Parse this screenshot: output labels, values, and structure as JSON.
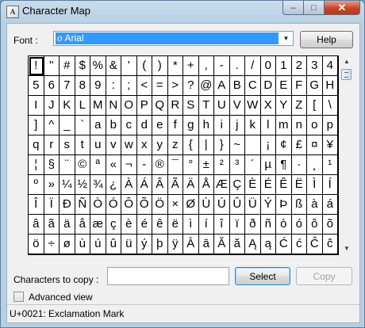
{
  "window": {
    "title": "Character Map",
    "icon_glyph": "A",
    "minimize_glyph": "–",
    "maximize_glyph": "□",
    "close_glyph": "✕"
  },
  "font": {
    "label": "Font :",
    "selected": "Arial",
    "icon": "O",
    "dropdown_glyph": "▼"
  },
  "help_label": "Help",
  "characters": [
    "!",
    "\"",
    "#",
    "$",
    "%",
    "&",
    "'",
    "(",
    ")",
    "*",
    "+",
    ",",
    "-",
    ".",
    "/",
    "0",
    "1",
    "2",
    "3",
    "4",
    "5",
    "6",
    "7",
    "8",
    "9",
    ":",
    ";",
    "<",
    "=",
    ">",
    "?",
    "@",
    "A",
    "B",
    "C",
    "D",
    "E",
    "F",
    "G",
    "H",
    "I",
    "J",
    "K",
    "L",
    "M",
    "N",
    "O",
    "P",
    "Q",
    "R",
    "S",
    "T",
    "U",
    "V",
    "W",
    "X",
    "Y",
    "Z",
    "[",
    "\\",
    "]",
    "^",
    "_",
    "`",
    "a",
    "b",
    "c",
    "d",
    "e",
    "f",
    "g",
    "h",
    "i",
    "j",
    "k",
    "l",
    "m",
    "n",
    "o",
    "p",
    "q",
    "r",
    "s",
    "t",
    "u",
    "v",
    "w",
    "x",
    "y",
    "z",
    "{",
    "|",
    "}",
    "~",
    " ",
    "¡",
    "¢",
    "£",
    "¤",
    "¥",
    "¦",
    "§",
    "¨",
    "©",
    "ª",
    "«",
    "¬",
    "-",
    "®",
    "¯",
    "°",
    "±",
    "²",
    "³",
    "´",
    "µ",
    "¶",
    "·",
    "¸",
    "¹",
    "º",
    "»",
    "¼",
    "½",
    "¾",
    "¿",
    "À",
    "Á",
    "Â",
    "Ã",
    "Ä",
    "Å",
    "Æ",
    "Ç",
    "È",
    "É",
    "Ê",
    "Ë",
    "Ì",
    "Í",
    "Î",
    "Ï",
    "Ð",
    "Ñ",
    "Ò",
    "Ó",
    "Ô",
    "Õ",
    "Ö",
    "×",
    "Ø",
    "Ù",
    "Ú",
    "Û",
    "Ü",
    "Ý",
    "Þ",
    "ß",
    "à",
    "á",
    "â",
    "ã",
    "ä",
    "å",
    "æ",
    "ç",
    "è",
    "é",
    "ê",
    "ë",
    "ì",
    "í",
    "î",
    "ï",
    "ð",
    "ñ",
    "ò",
    "ó",
    "ô",
    "õ",
    "ö",
    "÷",
    "ø",
    "ù",
    "ú",
    "û",
    "ü",
    "ý",
    "þ",
    "ÿ",
    "Ā",
    "ā",
    "Ă",
    "ă",
    "Ą",
    "ą",
    "Ć",
    "ć",
    "Ĉ",
    "ĉ"
  ],
  "selected_index": 0,
  "scrollbar": {
    "up_glyph": "▲",
    "down_glyph": "▼"
  },
  "copy": {
    "label": "Characters to copy :",
    "value": "",
    "select_label": "Select",
    "copy_label": "Copy"
  },
  "advanced_view_label": "Advanced view",
  "status": "U+0021: Exclamation Mark"
}
